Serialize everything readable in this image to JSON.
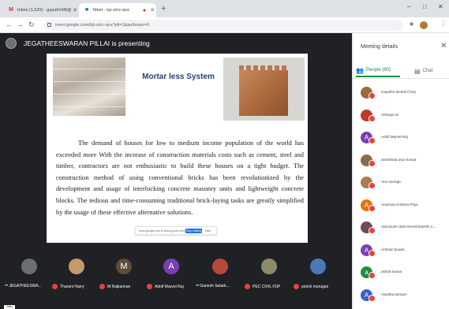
{
  "browser": {
    "tabs": [
      {
        "title": "Inbox (1,529) - gayathri08@gm...",
        "favicon": "gmail-icon",
        "active": false
      },
      {
        "title": "Meet - kjz-stcc-qce",
        "favicon": "meet-icon",
        "active": true
      }
    ],
    "url": "meet.google.com/kjz-stcc-qce?pli=1&authuser=0"
  },
  "meet": {
    "presenter_text": "JEGATHEESWARAN PILLAI is presenting",
    "slide": {
      "title": "Mortar less System",
      "body": "The demand of houses for low to medium income population of the world has exceeded more With the increase of construction materials costs such as cement, steel and timber, contractors are not enthusiastic to build these houses on a tight budget. The construction method of using conventional bricks has been revolutionized by the development and usage of interlocking concrete masonry units and lightweight concrete blocks. The tedious and time-consuming traditional brick-laying tasks are greatly simplified by the usage of these effective alternative solutions.",
      "share_banner": {
        "message": "meet.google.com is sharing your screen.",
        "stop_label": "Stop sharing",
        "hide_label": "Hide"
      }
    },
    "participants": [
      {
        "name": "JEGATHEESWA...",
        "initial": "",
        "color": "#6b6f73",
        "speaking": true
      },
      {
        "name": "Tharani Harry",
        "initial": "",
        "color": "#c49a6c",
        "speaking": false
      },
      {
        "name": "M Rajkannan",
        "initial": "M",
        "color": "#5f4b3b",
        "speaking": false
      },
      {
        "name": "Adolf Marvel Raj",
        "initial": "A",
        "color": "#7b3fb5",
        "speaking": false
      },
      {
        "name": "Ganesh Satark...",
        "initial": "",
        "color": "#b44a3a",
        "speaking": true
      },
      {
        "name": "PEC CIVIL FDP",
        "initial": "",
        "color": "#8c8c6c",
        "speaking": false
      },
      {
        "name": "petchi murugan",
        "initial": "",
        "color": "#4a7ab5",
        "speaking": false
      }
    ]
  },
  "panel": {
    "title": "Meeting details",
    "people_tab": "People (80)",
    "chat_tab": "Chat",
    "people": [
      {
        "name": "Gayathri senthil (You)",
        "initial": "",
        "color": "#9a6b3c"
      },
      {
        "name": "Abinaya M",
        "initial": "",
        "color": "#c0392b"
      },
      {
        "name": "Adolf Marvel Raj",
        "initial": "A",
        "color": "#7b3fb5"
      },
      {
        "name": "ananthala arun kumar",
        "initial": "",
        "color": "#8a6a4a"
      },
      {
        "name": "Anu George",
        "initial": "",
        "color": "#a87e4e"
      },
      {
        "name": "Anumolu Krishna Priya",
        "initial": "A",
        "color": "#e8710a"
      },
      {
        "name": "ANUSURI UMA MAHESWARI C...",
        "initial": "",
        "color": "#6d4c5c"
      },
      {
        "name": "Arshad Quadri",
        "initial": "A",
        "color": "#7b3fb5"
      },
      {
        "name": "ashok kumar",
        "initial": "a",
        "color": "#1e8e3e"
      },
      {
        "name": "Aswitha Menam",
        "initial": "A",
        "color": "#3c5fc8"
      }
    ]
  }
}
